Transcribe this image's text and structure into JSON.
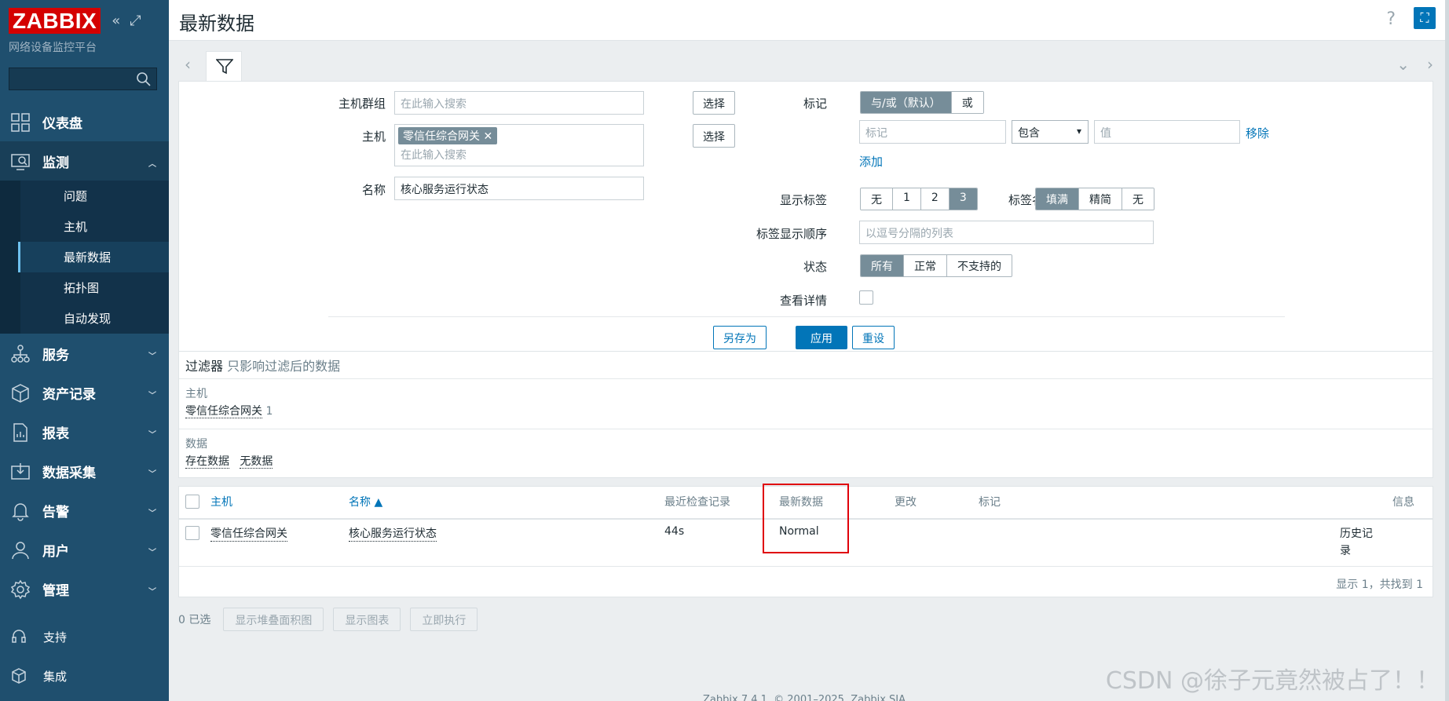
{
  "sidebar": {
    "logo": "ZABBIX",
    "subtitle": "网络设备监控平台",
    "menu": [
      {
        "label": "仪表盘"
      },
      {
        "label": "监测"
      },
      {
        "label": "服务"
      },
      {
        "label": "资产记录"
      },
      {
        "label": "报表"
      },
      {
        "label": "数据采集"
      },
      {
        "label": "告警"
      },
      {
        "label": "用户"
      },
      {
        "label": "管理"
      }
    ],
    "submenu": [
      "问题",
      "主机",
      "最新数据",
      "拓扑图",
      "自动发现"
    ],
    "bottom": [
      {
        "label": "支持"
      },
      {
        "label": "集成"
      }
    ]
  },
  "header": {
    "title": "最新数据",
    "help": "?"
  },
  "filter": {
    "host_group_label": "主机群组",
    "host_group_placeholder": "在此输入搜索",
    "select_label": "选择",
    "host_label": "主机",
    "host_chip": "零信任综合网关",
    "host_placeholder": "在此输入搜索",
    "name_label": "名称",
    "name_value": "核心服务运行状态",
    "tags_label": "标记",
    "tags_mode": [
      "与/或（默认）",
      "或"
    ],
    "tag_placeholder": "标记",
    "tag_operator": "包含",
    "tag_value_placeholder": "值",
    "remove_label": "移除",
    "add_label": "添加",
    "show_tags_label": "显示标签",
    "show_tags_options": [
      "无",
      "1",
      "2",
      "3"
    ],
    "tag_name_label": "标签名",
    "tag_name_options": [
      "填满",
      "精简",
      "无"
    ],
    "tag_order_label": "标签显示顺序",
    "tag_order_placeholder": "以逗号分隔的列表",
    "state_label": "状态",
    "state_options": [
      "所有",
      "正常",
      "不支持的"
    ],
    "details_label": "查看详情",
    "save_as": "另存为",
    "apply": "应用",
    "reset": "重设"
  },
  "summary": {
    "title": "过滤器",
    "hint": "只影响过滤后的数据",
    "host_label": "主机",
    "host_value": "零信任综合网关",
    "host_count": "1",
    "data_label": "数据",
    "data_with": "存在数据",
    "data_without": "无数据"
  },
  "table": {
    "columns": [
      "主机",
      "名称 ▲",
      "最近检查记录",
      "最新数据",
      "更改",
      "标记",
      "信息"
    ],
    "rows": [
      {
        "host": "零信任综合网关",
        "name": "核心服务运行状态",
        "last_check": "44s",
        "last_value": "Normal",
        "history_1": "历史记",
        "history_2": "录"
      }
    ],
    "count": "显示 1，共找到 1"
  },
  "actions": {
    "selected": "0 已选",
    "stacked": "显示堆叠面积图",
    "graph": "显示图表",
    "execute": "立即执行"
  },
  "footer": "Zabbix 7.4.1. © 2001–2025, Zabbix SIA",
  "watermark": "CSDN @徐子元竟然被占了！！",
  "colors": {
    "sidebar": "#1f4f6e",
    "accent": "#0275b8",
    "logo": "#d40000",
    "highlight": "#e0000a"
  }
}
